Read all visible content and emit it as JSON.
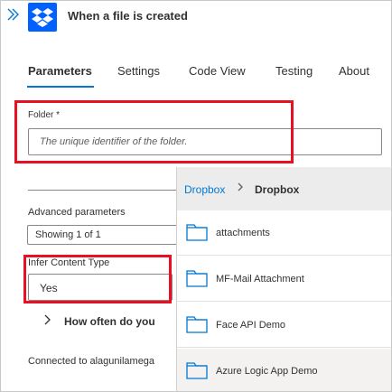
{
  "header": {
    "title": "When a file is created",
    "expand_icon": "double-chevron-right-icon",
    "logo_icon": "dropbox-logo-icon"
  },
  "tabs": [
    {
      "label": "Parameters",
      "active": true
    },
    {
      "label": "Settings",
      "active": false
    },
    {
      "label": "Code View",
      "active": false
    },
    {
      "label": "Testing",
      "active": false
    },
    {
      "label": "About",
      "active": false
    }
  ],
  "folder": {
    "label": "Folder *",
    "value": "",
    "placeholder": "The unique identifier of the folder."
  },
  "advanced": {
    "label": "Advanced parameters",
    "selected": "Showing 1 of 1"
  },
  "infer": {
    "label": "Infer Content Type",
    "selected": "Yes"
  },
  "often": {
    "label": "How often do you"
  },
  "connected": {
    "text": "Connected to alagunilamega"
  },
  "picker": {
    "breadcrumb_root": "Dropbox",
    "breadcrumb_sep": "›",
    "breadcrumb_current": "Dropbox",
    "folders": [
      {
        "name": "attachments"
      },
      {
        "name": "MF-Mail Attachment"
      },
      {
        "name": "Face API Demo"
      },
      {
        "name": "Azure Logic App Demo"
      }
    ]
  },
  "colors": {
    "accent": "#0078d4",
    "highlight": "#e81123",
    "dropbox_blue": "#0061fe"
  }
}
